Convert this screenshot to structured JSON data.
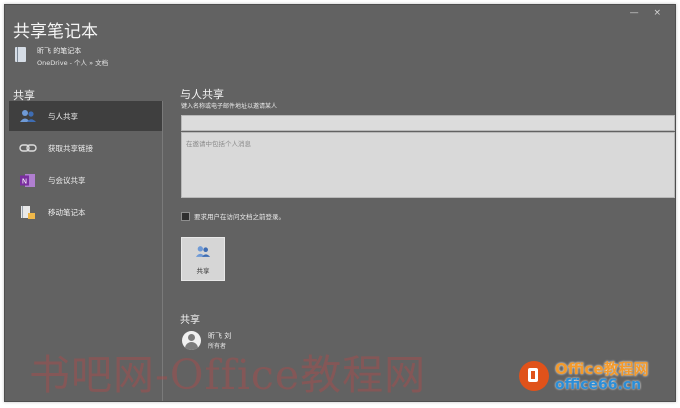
{
  "window": {
    "controls": "— ×"
  },
  "title": "共享笔记本",
  "notebook": {
    "name": "昕飞 的笔记本",
    "path": "OneDrive - 个人 » 文档"
  },
  "sidebar": {
    "heading": "共享",
    "items": [
      {
        "label": "与人共享",
        "icon": "people-icon",
        "active": true
      },
      {
        "label": "获取共享链接",
        "icon": "link-icon",
        "active": false
      },
      {
        "label": "与会议共享",
        "icon": "onenote-icon",
        "active": false
      },
      {
        "label": "移动笔记本",
        "icon": "move-notebook-icon",
        "active": false
      }
    ]
  },
  "share_panel": {
    "title": "与人共享",
    "subtitle": "键入名称或电子邮件地址以邀请某人",
    "names_value": "",
    "message_placeholder": "在邀请中包括个人消息",
    "signin_checkbox": {
      "label": "要求用户在访问文档之前登录。",
      "checked": false
    },
    "share_button": "共享"
  },
  "shared_with": {
    "heading": "共享",
    "user": {
      "name": "昕飞 刘",
      "role": "所有者"
    }
  },
  "watermark": {
    "text": "书吧网-Office教程网",
    "logo_text": "Office教程网",
    "site": "office66.cn"
  },
  "colors": {
    "panel_bg": "#626262",
    "active_item": "#3f3f3f",
    "people_icon": "#4a7cc4",
    "onenote": "#7a2ea0"
  }
}
